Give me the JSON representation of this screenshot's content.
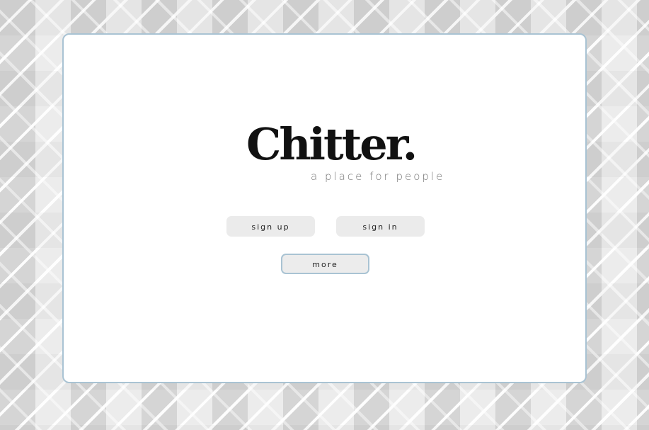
{
  "app": {
    "logo_text": "Chitter.",
    "tagline": "a place for people"
  },
  "actions": {
    "sign_up_label": "sign up",
    "sign_in_label": "sign in",
    "more_label": "more"
  },
  "colors": {
    "card_border": "#a9c3d3",
    "button_bg": "#ebebeb",
    "logo": "#111111",
    "tagline": "#777777"
  }
}
